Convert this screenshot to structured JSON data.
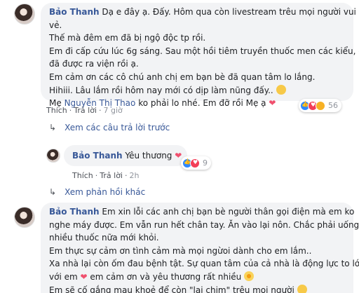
{
  "comment1": {
    "author": "Bảo Thanh",
    "line1": " Dạ e đây ạ. Đấy. Hôm qua còn livestream trêu mọi người vui",
    "line2": "vẻ.",
    "line3": "Thế mà đêm em đã bị ngộ độc tp rồi.",
    "line4": "Em đi cấp cứu lúc 6g sáng. Sau một hồi tiêm truyền thuốc men các kiểu, em",
    "line5": "đã được ra viện rồi ạ.",
    "line6": "Em cảm ơn các cô chú anh chị em bạn bè đã quan tâm lo lắng.",
    "line7": "Hihiii. Lâu lắm rồi hôm nay mới có dịp làm nũng đấy..",
    "line8_prefix": "Mẹ ",
    "line8_mention": "Nguyễn Thị Thao",
    "line8_suffix": " ko phải lo nhé. Em đỡ rồi Mẹ ạ",
    "like": "Thích",
    "reply": "Trả lời",
    "time": "7 giờ",
    "reaction_count": "56"
  },
  "view_previous": "Xem các câu trả lời trước",
  "reply1": {
    "author": "Bảo Thanh",
    "text": " Yêu thương",
    "like": "Thích",
    "reply": "Trả lời",
    "time": "2h",
    "reaction_count": "9"
  },
  "view_more": "Xem phản hồi khác",
  "comment2": {
    "author": "Bảo Thanh",
    "line1": " Em xin lỗi các anh chị bạn bè người thân gọi điện mà em ko",
    "line2": "nghe máy được. Em vẫn run hết chân tay. Ăn vào lại nôn. Chắc phải uống",
    "line3": "nhiều thuốc nữa mới khỏi.",
    "line4": "Em thực sự cảm ơn tình cảm mà mọi ngừoi dành cho em lắm..",
    "line5": "Xa nhà lại còn ốm đau bệnh tật. Sự quan tâm của cả nhà là động lực to lớn",
    "line6_a": "với em ",
    "line6_b": " em cảm ơn và yêu thương rất nhiều ",
    "line7": "Em sẽ cố gắng mau khoẻ để còn \"lai chim\" trêu mọi người "
  },
  "icons": {
    "heart": "heart-emoji",
    "grin": "grin-emoji",
    "flower": "flower-emoji",
    "arrow": "reply-arrow-icon"
  }
}
